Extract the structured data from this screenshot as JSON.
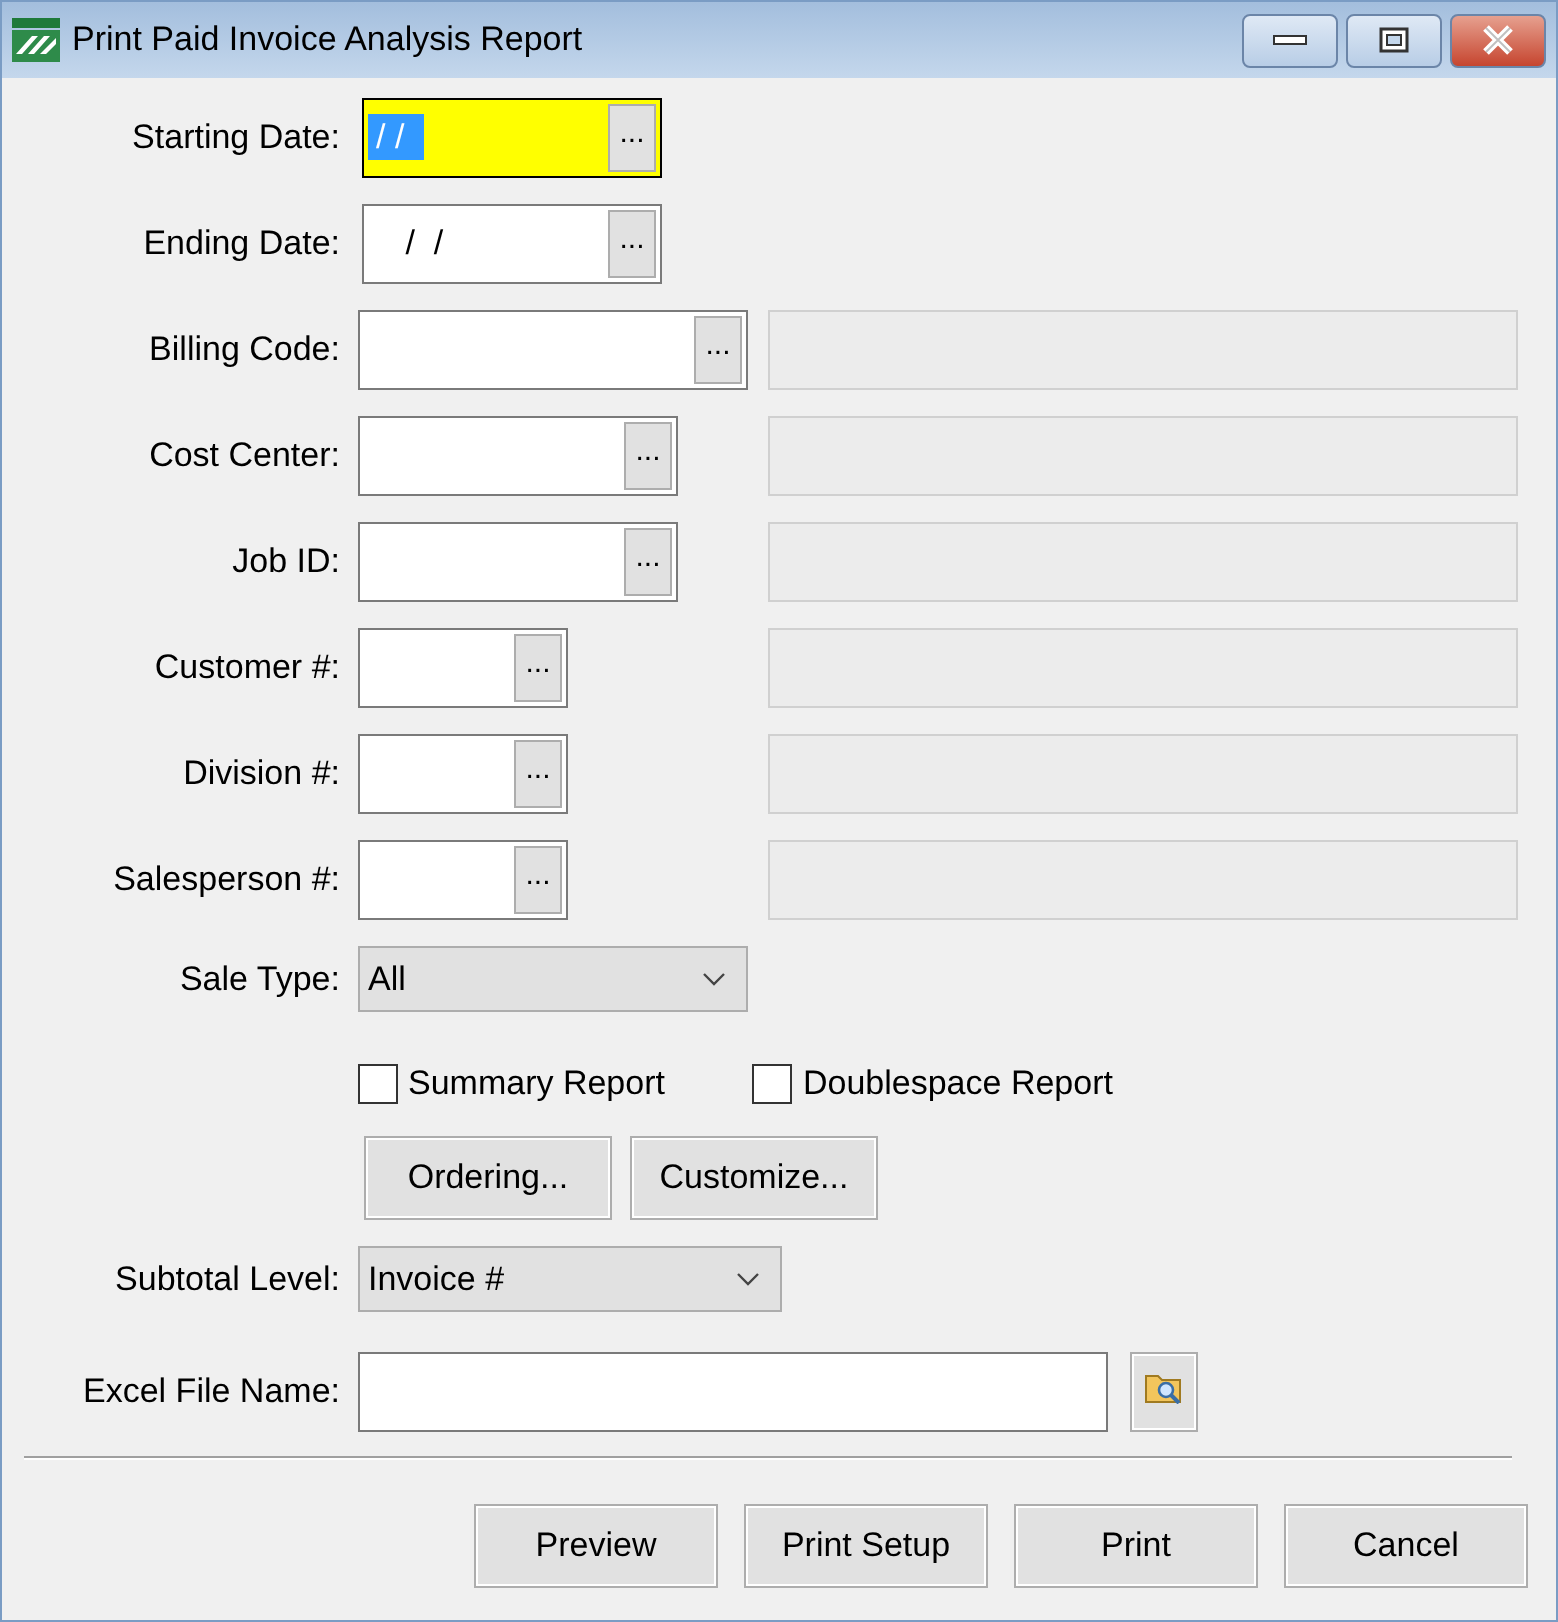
{
  "window": {
    "title": "Print Paid Invoice Analysis Report"
  },
  "fields": [
    {
      "label": "Starting Date:",
      "kind": "date",
      "value": "/ /",
      "focused": true,
      "button": "..."
    },
    {
      "label": "Ending Date:",
      "kind": "date",
      "value": " /  /",
      "focused": false,
      "button": "..."
    },
    {
      "label": "Billing Code:",
      "kind": "wide",
      "button": "..."
    },
    {
      "label": "Cost Center:",
      "kind": "medium",
      "button": "..."
    },
    {
      "label": "Job ID:",
      "kind": "medium",
      "button": "..."
    },
    {
      "label": "Customer #:",
      "kind": "narrow",
      "button": "..."
    },
    {
      "label": "Division #:",
      "kind": "narrow",
      "button": "..."
    },
    {
      "label": "Salesperson #:",
      "kind": "narrow",
      "button": "..."
    }
  ],
  "sale_type": {
    "label": "Sale Type:",
    "value": "All"
  },
  "checkboxes": [
    {
      "label": "Summary Report",
      "checked": false
    },
    {
      "label": "Doublespace Report",
      "checked": false
    }
  ],
  "option_buttons": [
    "Ordering...",
    "Customize..."
  ],
  "subtotal_level": {
    "label": "Subtotal Level:",
    "value": "Invoice #"
  },
  "excel_file": {
    "label": "Excel File Name:"
  },
  "buttons": [
    "Preview",
    "Print Setup",
    "Print",
    "Cancel"
  ]
}
